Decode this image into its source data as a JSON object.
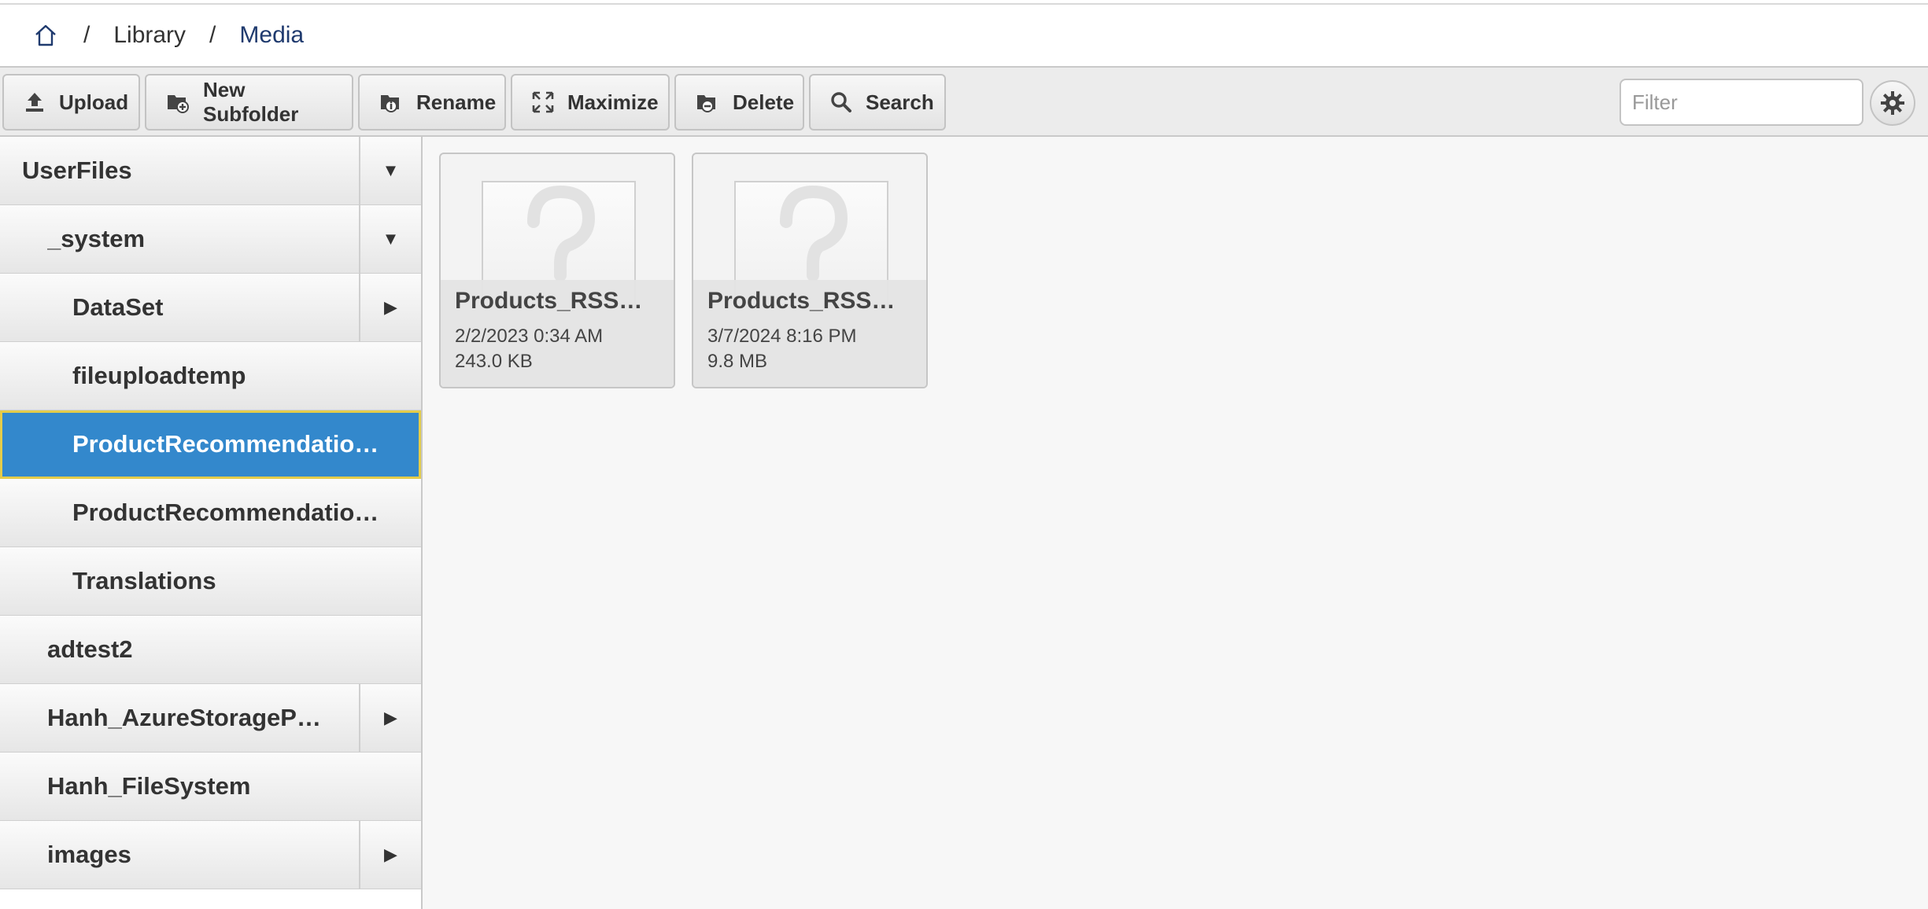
{
  "breadcrumb": {
    "separator": "/",
    "items": [
      "Library",
      "Media"
    ]
  },
  "toolbar": {
    "upload": "Upload",
    "new_subfolder": "New Subfolder",
    "rename": "Rename",
    "maximize": "Maximize",
    "delete": "Delete",
    "search": "Search",
    "filter_placeholder": "Filter"
  },
  "tree": [
    {
      "label": "UserFiles",
      "toggle": "▼",
      "selected": false
    },
    {
      "label": "_system",
      "toggle": "▼",
      "selected": false
    },
    {
      "label": "DataSet",
      "toggle": "▶",
      "selected": false
    },
    {
      "label": "fileuploadtemp",
      "toggle": "",
      "selected": false
    },
    {
      "label": "ProductRecommendatio…",
      "toggle": "",
      "selected": true
    },
    {
      "label": "ProductRecommendatio…",
      "toggle": "",
      "selected": false
    },
    {
      "label": "Translations",
      "toggle": "",
      "selected": false
    },
    {
      "label": "adtest2",
      "toggle": "",
      "selected": false
    },
    {
      "label": "Hanh_AzureStorageP…",
      "toggle": "▶",
      "selected": false
    },
    {
      "label": "Hanh_FileSystem",
      "toggle": "",
      "selected": false
    },
    {
      "label": "images",
      "toggle": "▶",
      "selected": false
    }
  ],
  "files": [
    {
      "name": "Products_RSS…",
      "date": "2/2/2023 0:34 AM",
      "size": "243.0 KB"
    },
    {
      "name": "Products_RSS…",
      "date": "3/7/2024 8:16 PM",
      "size": "9.8 MB"
    }
  ],
  "colors": {
    "selected_bg": "#3388cc",
    "selected_border": "#e3cc4a",
    "breadcrumb_current": "#1f3a6e"
  }
}
